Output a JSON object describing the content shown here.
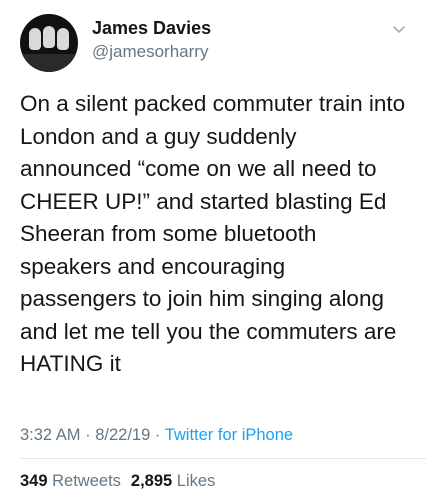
{
  "author": {
    "display_name": "James Davies",
    "handle": "@jamesorharry"
  },
  "tweet": {
    "text_lines": [
      "On a silent packed commuter train into",
      "London and a guy suddenly",
      "announced “come on we all need to",
      "CHEER UP!” and started blasting Ed",
      "Sheeran from some bluetooth",
      "speakers and encouraging",
      "passengers to join him singing along",
      "and let me tell you the commuters are",
      "HATING it"
    ],
    "time": "3:32 AM",
    "date": "8/22/19",
    "separator": "·",
    "source": "Twitter for iPhone"
  },
  "stats": {
    "retweets_count": "349",
    "retweets_label": "Retweets",
    "likes_count": "2,895",
    "likes_label": "Likes"
  },
  "icons": {
    "menu": "chevron-down-icon"
  },
  "colors": {
    "text": "#14171a",
    "secondary": "#657786",
    "link": "#1da1f2",
    "divider": "#e1e8ed"
  }
}
